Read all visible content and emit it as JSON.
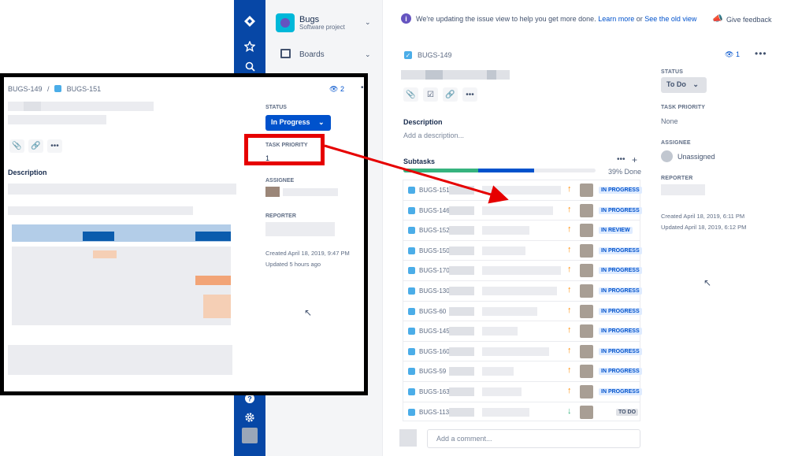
{
  "banner": {
    "text": "We're updating the issue view to help you get more done.",
    "learn_more": "Learn more",
    "or": "or",
    "old_view": "See the old view",
    "feedback": "Give feedback"
  },
  "project": {
    "name": "Bugs",
    "type": "Software project",
    "boards_label": "Boards"
  },
  "issue": {
    "key": "BUGS-149",
    "watchers": "1",
    "description_heading": "Description",
    "description_placeholder": "Add a description...",
    "subtasks_heading": "Subtasks",
    "progress_label": "39% Done",
    "progress_done_fraction": 0.39,
    "progress_inprogress_fraction": 0.29,
    "comment_placeholder": "Add a comment...",
    "subtasks": [
      {
        "key": "BUGS-151",
        "priority": "up",
        "status": "IN PROGRESS"
      },
      {
        "key": "BUGS-146",
        "priority": "up",
        "status": "IN PROGRESS"
      },
      {
        "key": "BUGS-152",
        "priority": "up",
        "status": "IN REVIEW"
      },
      {
        "key": "BUGS-150",
        "priority": "up",
        "status": "IN PROGRESS"
      },
      {
        "key": "BUGS-170",
        "priority": "up",
        "status": "IN PROGRESS"
      },
      {
        "key": "BUGS-130",
        "priority": "up",
        "status": "IN PROGRESS"
      },
      {
        "key": "BUGS-60",
        "priority": "up",
        "status": "IN PROGRESS"
      },
      {
        "key": "BUGS-145",
        "priority": "up",
        "status": "IN PROGRESS"
      },
      {
        "key": "BUGS-160",
        "priority": "up",
        "status": "IN PROGRESS"
      },
      {
        "key": "BUGS-59",
        "priority": "up",
        "status": "IN PROGRESS"
      },
      {
        "key": "BUGS-163",
        "priority": "up",
        "status": "IN PROGRESS"
      },
      {
        "key": "BUGS-113",
        "priority": "down",
        "status": "TO DO"
      }
    ]
  },
  "details": {
    "status_label": "STATUS",
    "status_value": "To Do",
    "priority_label": "TASK PRIORITY",
    "priority_value": "None",
    "assignee_label": "ASSIGNEE",
    "assignee_value": "Unassigned",
    "reporter_label": "REPORTER",
    "created": "Created April 18, 2019, 6:11 PM",
    "updated": "Updated April 18, 2019, 6:12 PM"
  },
  "overlay": {
    "parent_key": "BUGS-149",
    "separator": "/",
    "child_key": "BUGS-151",
    "watchers": "2",
    "status_label": "STATUS",
    "status_value": "In Progress",
    "priority_label": "TASK PRIORITY",
    "priority_value": "1",
    "assignee_label": "ASSIGNEE",
    "reporter_label": "REPORTER",
    "created": "Created April 18, 2019, 9:47 PM",
    "updated": "Updated 5 hours ago",
    "description_heading": "Description"
  },
  "colors": {
    "nav_blue": "#0747a6",
    "link_blue": "#0052cc",
    "annotation_red": "#e60000",
    "done_green": "#36b37e",
    "priority_up": "#ff8b00",
    "priority_down": "#36b37e"
  },
  "icons": {
    "rail": [
      "jira-logo-icon",
      "star-icon",
      "search-icon",
      "help-icon",
      "settings-icon"
    ],
    "toolbar": [
      "attach-icon",
      "subtask-icon",
      "link-icon",
      "more-icon"
    ]
  }
}
